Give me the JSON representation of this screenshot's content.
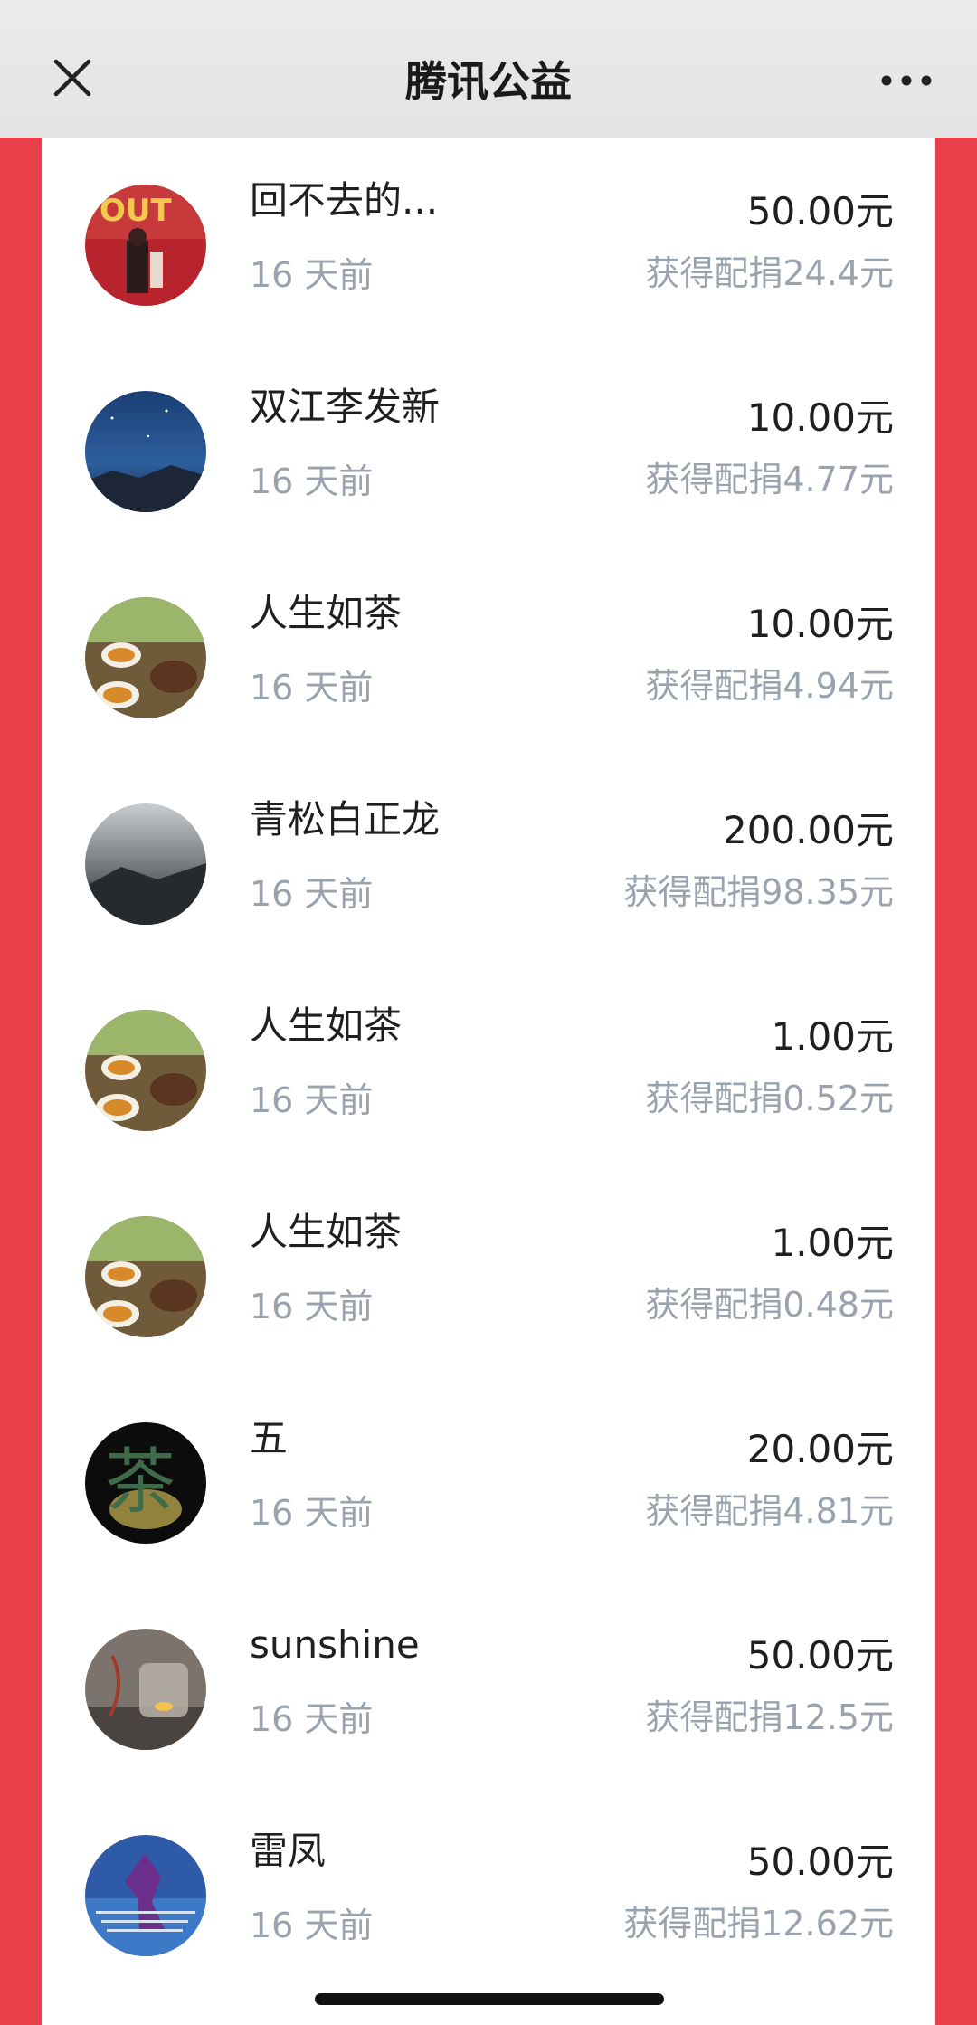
{
  "header": {
    "title": "腾讯公益"
  },
  "donations": [
    {
      "name": "回不去的...",
      "time": "16 天前",
      "amount": "50.00元",
      "match": "获得配捐24.4元",
      "avatar": "photo-avatar-1"
    },
    {
      "name": "双江李发新",
      "time": "16 天前",
      "amount": "10.00元",
      "match": "获得配捐4.77元",
      "avatar": "night-sky-avatar"
    },
    {
      "name": "人生如茶",
      "time": "16 天前",
      "amount": "10.00元",
      "match": "获得配捐4.94元",
      "avatar": "tea-cups-avatar"
    },
    {
      "name": "青松白正龙",
      "time": "16 天前",
      "amount": "200.00元",
      "match": "获得配捐98.35元",
      "avatar": "mist-mountain-avatar"
    },
    {
      "name": "人生如茶",
      "time": "16 天前",
      "amount": "1.00元",
      "match": "获得配捐0.52元",
      "avatar": "tea-cups-avatar"
    },
    {
      "name": "人生如茶",
      "time": "16 天前",
      "amount": "1.00元",
      "match": "获得配捐0.48元",
      "avatar": "tea-cups-avatar"
    },
    {
      "name": "五",
      "time": "16 天前",
      "amount": "20.00元",
      "match": "获得配捐4.81元",
      "avatar": "tea-character-avatar"
    },
    {
      "name": "sunshine",
      "time": "16 天前",
      "amount": "50.00元",
      "match": "获得配捐12.5元",
      "avatar": "candle-jar-avatar"
    },
    {
      "name": "雷凤",
      "time": "16 天前",
      "amount": "50.00元",
      "match": "获得配捐12.62元",
      "avatar": "blue-figure-avatar"
    }
  ],
  "colors": {
    "accent_red": "#e8404a",
    "header_bg": "#e8e8e8",
    "secondary_text": "#9aa3ad",
    "primary_text": "#1f1f1f"
  }
}
